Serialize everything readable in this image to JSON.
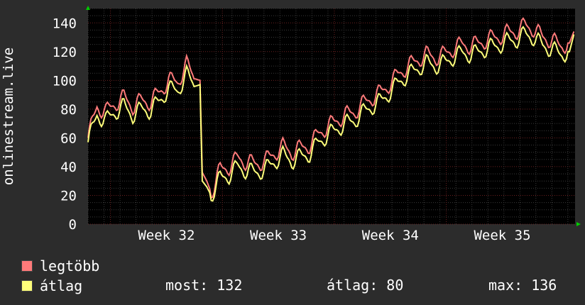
{
  "chart_data": {
    "type": "line",
    "ylabel": "onlinestream.live",
    "ylim": [
      0,
      150
    ],
    "yticks": [
      0,
      20,
      40,
      60,
      80,
      100,
      120,
      140
    ],
    "xticks": [
      "Week 32",
      "Week 33",
      "Week 34",
      "Week 35"
    ],
    "xrange": [
      0,
      4.35
    ],
    "xtick_positions": [
      0.7,
      1.7,
      2.7,
      3.7
    ],
    "grid": true,
    "background": "#000000",
    "colors": {
      "legtobb": "#ff7a7a",
      "atlag": "#ffff7a",
      "grid_major": "#6b2020",
      "grid_minor": "#3a3a3a"
    },
    "series": [
      {
        "name": "legtöbb",
        "color": "#ff7a7a",
        "x": [
          0.0,
          0.08,
          0.16,
          0.24,
          0.32,
          0.4,
          0.48,
          0.56,
          0.64,
          0.72,
          0.8,
          0.88,
          0.96,
          1.0,
          1.02,
          1.06,
          1.1,
          1.18,
          1.26,
          1.34,
          1.42,
          1.5,
          1.58,
          1.66,
          1.74,
          1.82,
          1.9,
          1.98,
          2.06,
          2.14,
          2.22,
          2.3,
          2.38,
          2.46,
          2.54,
          2.62,
          2.7,
          2.78,
          2.86,
          2.94,
          3.02,
          3.1,
          3.18,
          3.26,
          3.34,
          3.42,
          3.5,
          3.58,
          3.66,
          3.74,
          3.82,
          3.9,
          3.98,
          4.06,
          4.14,
          4.22,
          4.3,
          4.34
        ],
        "values": [
          60,
          82,
          78,
          84,
          88,
          82,
          86,
          85,
          92,
          100,
          99,
          111,
          101,
          100,
          36,
          30,
          22,
          38,
          40,
          46,
          43,
          42,
          44,
          49,
          54,
          50,
          53,
          55,
          63,
          68,
          72,
          76,
          78,
          84,
          88,
          92,
          98,
          105,
          110,
          114,
          118,
          116,
          118,
          122,
          125,
          124,
          126,
          129,
          130,
          133,
          134,
          138,
          136,
          130,
          128,
          124,
          126,
          134
        ]
      },
      {
        "name": "átlag",
        "color": "#ffff7a",
        "x": [
          0.0,
          0.08,
          0.16,
          0.24,
          0.32,
          0.4,
          0.48,
          0.56,
          0.64,
          0.72,
          0.8,
          0.88,
          0.96,
          1.0,
          1.02,
          1.06,
          1.1,
          1.18,
          1.26,
          1.34,
          1.42,
          1.5,
          1.58,
          1.66,
          1.74,
          1.82,
          1.9,
          1.98,
          2.06,
          2.14,
          2.22,
          2.3,
          2.38,
          2.46,
          2.54,
          2.62,
          2.7,
          2.78,
          2.86,
          2.94,
          3.02,
          3.1,
          3.18,
          3.26,
          3.34,
          3.42,
          3.5,
          3.58,
          3.66,
          3.74,
          3.82,
          3.9,
          3.98,
          4.06,
          4.14,
          4.22,
          4.3,
          4.34
        ],
        "values": [
          57,
          76,
          72,
          78,
          82,
          76,
          80,
          79,
          86,
          94,
          93,
          104,
          96,
          97,
          30,
          26,
          20,
          32,
          34,
          40,
          37,
          36,
          38,
          43,
          48,
          44,
          47,
          49,
          57,
          62,
          66,
          70,
          72,
          78,
          82,
          86,
          92,
          99,
          104,
          108,
          112,
          110,
          112,
          116,
          119,
          118,
          120,
          123,
          124,
          127,
          128,
          132,
          130,
          124,
          122,
          118,
          120,
          132
        ]
      }
    ]
  },
  "legend": [
    {
      "label": "legtöbb",
      "color": "#ff7a7a"
    },
    {
      "label": "átlag",
      "color": "#ffff7a"
    }
  ],
  "stats": {
    "most": "most: 132",
    "atlag": "átlag: 80",
    "max": "max: 136"
  }
}
